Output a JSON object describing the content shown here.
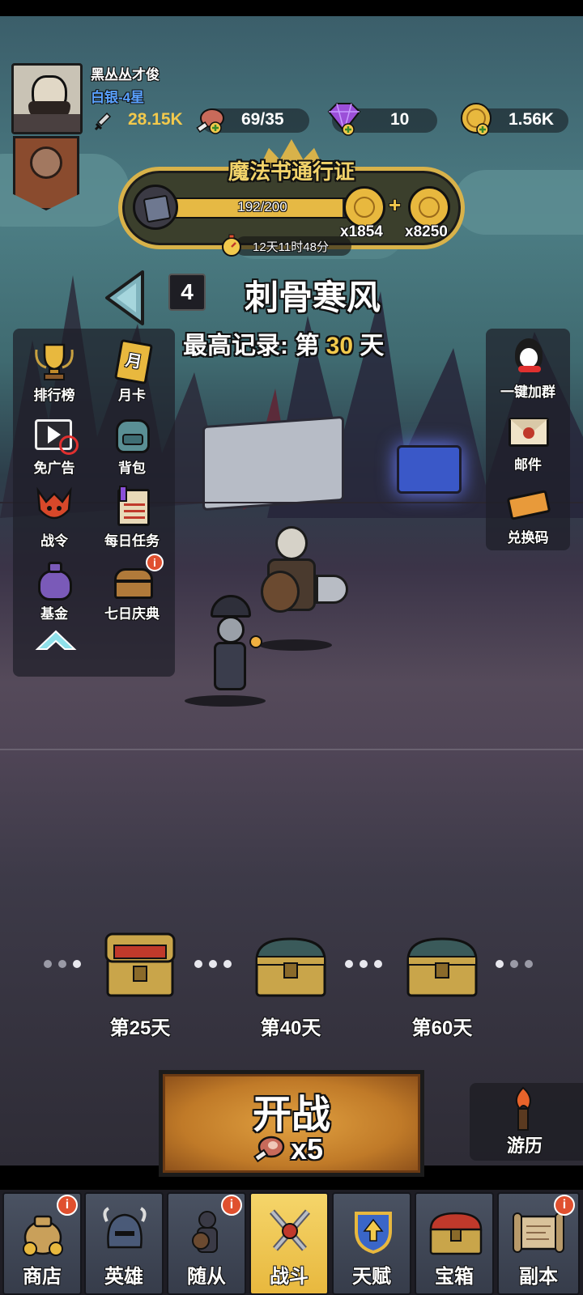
{
  "player": {
    "name": "黑丛丛才俊",
    "rank": "白银-4星",
    "power": "28.15K"
  },
  "resources": {
    "stamina": "69/35",
    "gems": "10",
    "gold": "1.56K"
  },
  "pass": {
    "title": "魔法书通行证",
    "progress_text": "192/200",
    "progress_fraction": 0.96,
    "reward_left_count": "x1854",
    "reward_right_count": "x8250",
    "timer": "12天11时48分"
  },
  "stage": {
    "number": "4",
    "name": "刺骨寒风",
    "record_prefix": "最高记录: 第",
    "record_day": "30",
    "record_suffix": "天"
  },
  "left_menu": [
    {
      "label": "排行榜",
      "icon": "trophy-icon"
    },
    {
      "label": "月卡",
      "icon": "month-card-icon",
      "icon_text": "月"
    },
    {
      "label": "免广告",
      "icon": "no-ads-icon"
    },
    {
      "label": "背包",
      "icon": "backpack-icon"
    },
    {
      "label": "战令",
      "icon": "battle-pass-icon"
    },
    {
      "label": "每日任务",
      "icon": "daily-task-icon"
    },
    {
      "label": "基金",
      "icon": "fund-bag-icon"
    },
    {
      "label": "七日庆典",
      "icon": "seven-day-chest-icon",
      "badge": "i"
    }
  ],
  "right_menu": [
    {
      "label": "一键加群",
      "icon": "qq-penguin-icon"
    },
    {
      "label": "邮件",
      "icon": "mail-icon"
    },
    {
      "label": "兑换码",
      "icon": "ticket-icon"
    }
  ],
  "chests": [
    {
      "label": "第25天",
      "state": "open"
    },
    {
      "label": "第40天",
      "state": "closed"
    },
    {
      "label": "第60天",
      "state": "closed"
    }
  ],
  "start_button": {
    "label": "开战",
    "cost": "x5"
  },
  "travel": {
    "label": "游历"
  },
  "nav": [
    {
      "label": "商店",
      "icon": "gold-bag-icon",
      "badge": "i"
    },
    {
      "label": "英雄",
      "icon": "helmet-icon"
    },
    {
      "label": "随从",
      "icon": "follower-icon",
      "badge": "i"
    },
    {
      "label": "战斗",
      "icon": "crossed-swords-icon",
      "active": true
    },
    {
      "label": "天赋",
      "icon": "talent-shield-icon"
    },
    {
      "label": "宝箱",
      "icon": "treasure-chest-icon"
    },
    {
      "label": "副本",
      "icon": "scroll-map-icon",
      "badge": "i"
    }
  ],
  "colors": {
    "accent_gold": "#f2c94c",
    "rank_blue": "#5aa2ff",
    "badge_red": "#e0502f",
    "start_button": "#c98a2d"
  }
}
